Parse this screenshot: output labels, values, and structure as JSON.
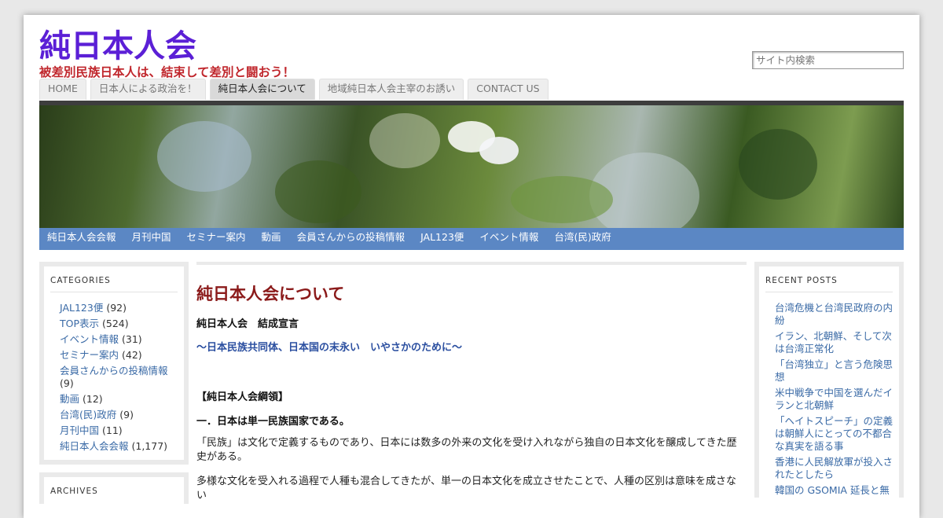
{
  "site": {
    "title": "純日本人会",
    "tagline": "被差別民族日本人は、結束して差別と闘おう！",
    "search_placeholder": "サイト内検索"
  },
  "tabs": [
    {
      "label": "HOME"
    },
    {
      "label": "日本人による政治を！"
    },
    {
      "label": "純日本人会について",
      "active": true
    },
    {
      "label": "地域純日本人会主宰のお誘い"
    },
    {
      "label": "CONTACT US"
    }
  ],
  "nav": [
    {
      "label": "純日本人会会報"
    },
    {
      "label": "月刊中国"
    },
    {
      "label": "セミナー案内"
    },
    {
      "label": "動画"
    },
    {
      "label": "会員さんからの投稿情報"
    },
    {
      "label": "JAL123便"
    },
    {
      "label": "イベント情報"
    },
    {
      "label": "台湾(民)政府"
    }
  ],
  "categories": {
    "title": "CATEGORIES",
    "items": [
      {
        "label": "JAL123便",
        "count": "(92)"
      },
      {
        "label": "TOP表示",
        "count": "(524)"
      },
      {
        "label": "イベント情報",
        "count": "(31)"
      },
      {
        "label": "セミナー案内",
        "count": "(42)"
      },
      {
        "label": "会員さんからの投稿情報",
        "count": "(9)"
      },
      {
        "label": "動画",
        "count": "(12)"
      },
      {
        "label": "台湾(民)政府",
        "count": "(9)"
      },
      {
        "label": "月刊中国",
        "count": "(11)"
      },
      {
        "label": "純日本人会会報",
        "count": "(1,177)"
      }
    ]
  },
  "archives": {
    "title": "ARCHIVES"
  },
  "recent_posts": {
    "title": "RECENT POSTS",
    "items": [
      "台湾危機と台湾民政府の内紛",
      "イラン、北朝鮮、そして次は台湾正常化",
      "「台湾独立」と言う危険思想",
      "米中戦争で中国を選んだイランと北朝鮮",
      "「ヘイトスピーチ」の定義は朝鮮人にとっての不都合な真実を語る事",
      "香港に人民解放軍が投入されたとしたら",
      "韓国の GSOMIA 延長と無"
    ]
  },
  "content": {
    "title": "純日本人会について",
    "subtitle": "純日本人会　結成宣言",
    "slogan": "～日本民族共同体、日本国の末永い　いやさかのために～",
    "section_heading": "【純日本人会綱領】",
    "point_1": "一．日本は単一民族国家である。",
    "para_1": "「民族」は文化で定義するものであり、日本には数多の外来の文化を受け入れながら独自の日本文化を醸成してきた歴史がある。",
    "para_2": "多様な文化を受入れる過程で人種も混合してきたが、単一の日本文化を成立させたことで、人種の区別は意味を成さない"
  }
}
